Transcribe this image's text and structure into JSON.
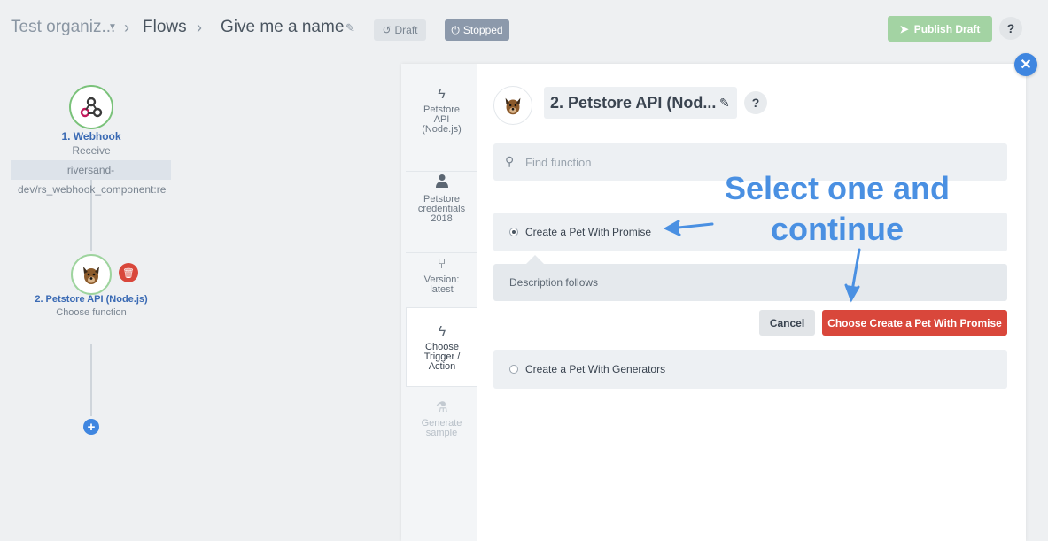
{
  "breadcrumb": {
    "org": "Test organiz...",
    "flows": "Flows",
    "flow_name": "Give me a name",
    "sep": ">"
  },
  "badges": {
    "draft": "Draft",
    "stopped": "Stopped"
  },
  "toolbar": {
    "publish_label": "Publish Draft",
    "help": "?"
  },
  "flow": {
    "node1": {
      "title": "1. Webhook",
      "subtitle": "Receive",
      "tag": "riversand-",
      "path": "dev/rs_webhook_component:re"
    },
    "node2": {
      "title": "2. Petstore API (Node.js)",
      "subtitle": "Choose function"
    }
  },
  "steps": [
    {
      "icon": "lightning-icon",
      "label_lines": [
        "Petstore",
        "API",
        "(Node.js)"
      ]
    },
    {
      "icon": "user-icon",
      "label_lines": [
        "Petstore",
        "credentials",
        "2018"
      ]
    },
    {
      "icon": "branch-icon",
      "label_lines": [
        "Version:",
        "latest"
      ]
    },
    {
      "icon": "lightning-icon",
      "label_lines": [
        "Choose",
        "Trigger /",
        "Action"
      ],
      "active": true
    },
    {
      "icon": "flask-icon",
      "label_lines": [
        "Generate",
        "sample"
      ],
      "disabled": true
    }
  ],
  "panel": {
    "title": "2. Petstore API (Nod...",
    "help": "?",
    "search_placeholder": "Find function",
    "options": [
      {
        "label": "Create a Pet With Promise",
        "selected": true
      },
      {
        "label": "Create a Pet With Generators",
        "selected": false
      }
    ],
    "description": "Description follows",
    "cancel_label": "Cancel",
    "choose_label": "Choose Create a Pet With Promise"
  },
  "annotation": {
    "line1": "Select one and",
    "line2": "continue"
  },
  "colors": {
    "accent_blue": "#4a90e2",
    "danger": "#d9473b",
    "success_light": "#a3d3a3"
  }
}
